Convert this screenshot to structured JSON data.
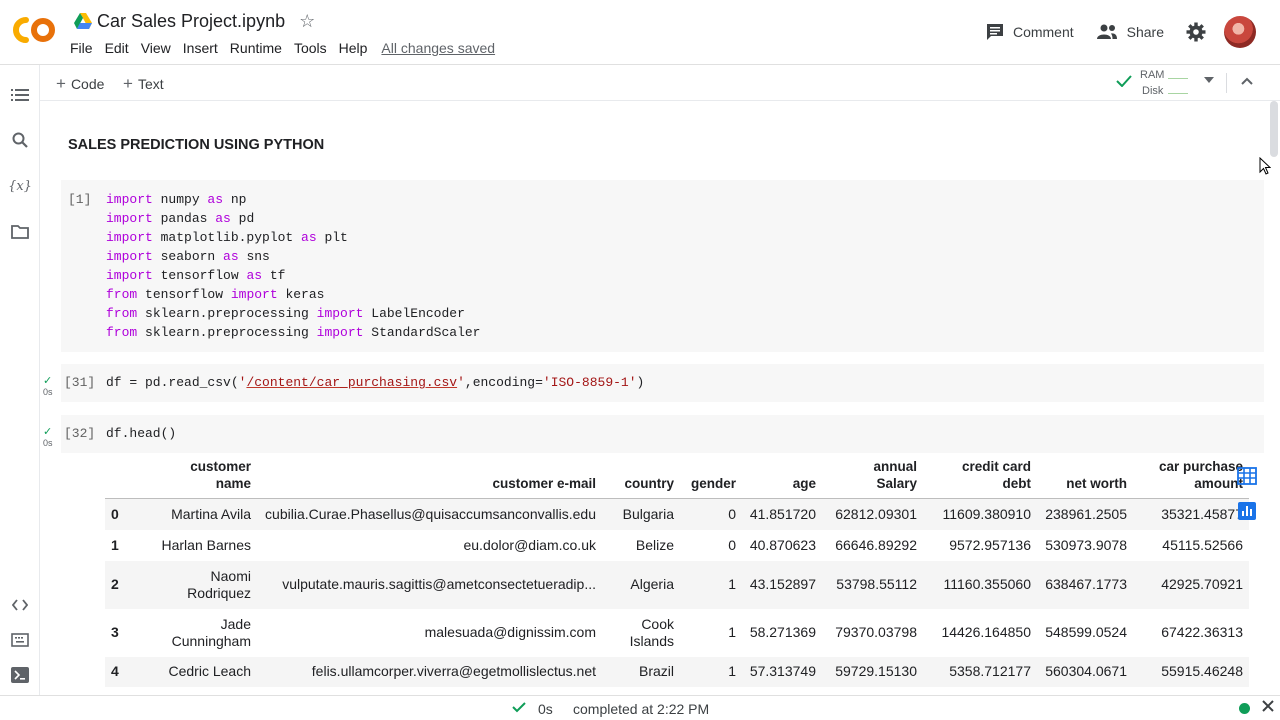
{
  "app": {
    "logo_text": "CO",
    "doc_title": "Car Sales Project.ipynb",
    "menu": [
      "File",
      "Edit",
      "View",
      "Insert",
      "Runtime",
      "Tools",
      "Help"
    ],
    "saved_status": "All changes saved",
    "comment_label": "Comment",
    "share_label": "Share"
  },
  "toolbar": {
    "add_code_label": "Code",
    "add_text_label": "Text",
    "ram_label": "RAM",
    "disk_label": "Disk"
  },
  "notebook": {
    "heading": "SALES PREDICTION USING PYTHON",
    "cell1": {
      "exec": "[1]",
      "lines": [
        {
          "kw": "import",
          "rest": " numpy ",
          "kw2": "as",
          "tail": " np"
        },
        {
          "kw": "import",
          "rest": " pandas ",
          "kw2": "as",
          "tail": " pd"
        },
        {
          "kw": "import",
          "rest": " matplotlib.pyplot ",
          "kw2": "as",
          "tail": " plt"
        },
        {
          "kw": "import",
          "rest": " seaborn ",
          "kw2": "as",
          "tail": " sns"
        },
        {
          "kw": "import",
          "rest": " tensorflow ",
          "kw2": "as",
          "tail": " tf"
        },
        {
          "kw": "from",
          "rest": " tensorflow ",
          "kw2": "import",
          "tail": " keras"
        },
        {
          "kw": "from",
          "rest": " sklearn.preprocessing ",
          "kw2": "import",
          "tail": " LabelEncoder"
        },
        {
          "kw": "from",
          "rest": " sklearn.preprocessing ",
          "kw2": "import",
          "tail": " StandardScaler"
        }
      ]
    },
    "cell2": {
      "exec": "[31]",
      "runtime": "0s",
      "code_a": "df = pd.read_csv(",
      "str_q1": "'",
      "str_path": "/content/car_purchasing.csv",
      "str_q2": "'",
      "code_b": ",encoding=",
      "str_enc": "'ISO-8859-1'",
      "code_c": ")"
    },
    "cell3": {
      "exec": "[32]",
      "runtime": "0s",
      "code": "df.head()"
    },
    "table": {
      "headers": [
        [
          "customer",
          "name"
        ],
        [
          "customer e-mail",
          ""
        ],
        [
          "country",
          ""
        ],
        [
          "gender",
          ""
        ],
        [
          "age",
          ""
        ],
        [
          "annual",
          "Salary"
        ],
        [
          "credit card",
          "debt"
        ],
        [
          "net worth",
          ""
        ],
        [
          "car purchase",
          "amount"
        ]
      ],
      "rows": [
        {
          "idx": "0",
          "name1": "Martina Avila",
          "name2": "",
          "email": "cubilia.Curae.Phasellus@quisaccumsanconvallis.edu",
          "country1": "Bulgaria",
          "country2": "",
          "gender": "0",
          "age": "41.851720",
          "salary": "62812.09301",
          "debt": "11609.380910",
          "worth": "238961.2505",
          "amount": "35321.45877"
        },
        {
          "idx": "1",
          "name1": "Harlan Barnes",
          "name2": "",
          "email": "eu.dolor@diam.co.uk",
          "country1": "Belize",
          "country2": "",
          "gender": "0",
          "age": "40.870623",
          "salary": "66646.89292",
          "debt": "9572.957136",
          "worth": "530973.9078",
          "amount": "45115.52566"
        },
        {
          "idx": "2",
          "name1": "Naomi",
          "name2": "Rodriquez",
          "email": "vulputate.mauris.sagittis@ametconsectetueradip...",
          "country1": "Algeria",
          "country2": "",
          "gender": "1",
          "age": "43.152897",
          "salary": "53798.55112",
          "debt": "11160.355060",
          "worth": "638467.1773",
          "amount": "42925.70921"
        },
        {
          "idx": "3",
          "name1": "Jade",
          "name2": "Cunningham",
          "email": "malesuada@dignissim.com",
          "country1": "Cook",
          "country2": "Islands",
          "gender": "1",
          "age": "58.271369",
          "salary": "79370.03798",
          "debt": "14426.164850",
          "worth": "548599.0524",
          "amount": "67422.36313"
        },
        {
          "idx": "4",
          "name1": "Cedric Leach",
          "name2": "",
          "email": "felis.ullamcorper.viverra@egetmollislectus.net",
          "country1": "Brazil",
          "country2": "",
          "gender": "1",
          "age": "57.313749",
          "salary": "59729.15130",
          "debt": "5358.712177",
          "worth": "560304.0671",
          "amount": "55915.46248"
        }
      ]
    }
  },
  "statusbar": {
    "elapsed": "0s",
    "text": "completed at 2:22 PM"
  },
  "colors": {
    "keyword": "#af00db",
    "keyword2": "#0000ff",
    "string": "#a31515",
    "check": "#0f9d58",
    "accent": "#1a73e8"
  }
}
